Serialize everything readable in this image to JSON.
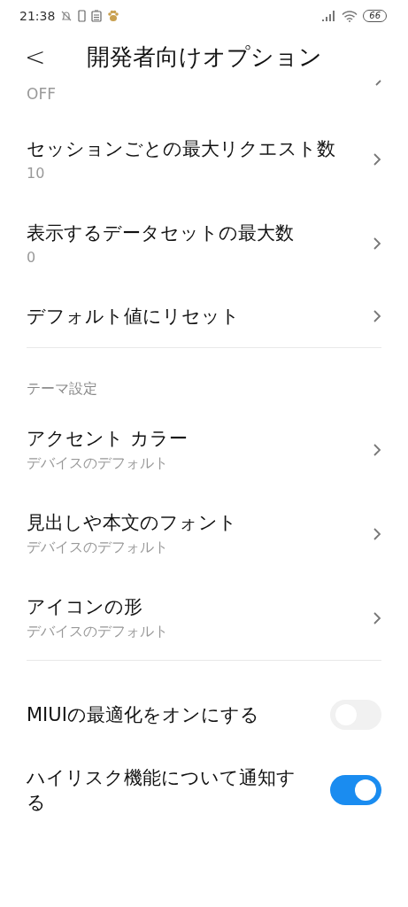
{
  "status_bar": {
    "time": "21:38",
    "battery": "66"
  },
  "header": {
    "back": "<",
    "title": "開発者向けオプション"
  },
  "sections": [
    {
      "items": [
        {
          "kind": "cut",
          "value": "OFF"
        },
        {
          "kind": "link",
          "title": "セッションごとの最大リクエスト数",
          "value": "10"
        },
        {
          "kind": "link",
          "title": "表示するデータセットの最大数",
          "value": "0"
        },
        {
          "kind": "link",
          "title": "デフォルト値にリセット"
        }
      ]
    },
    {
      "heading": "テーマ設定",
      "items": [
        {
          "kind": "link",
          "title": "アクセント カラー",
          "value": "デバイスのデフォルト"
        },
        {
          "kind": "link",
          "title": "見出しや本文のフォント",
          "value": "デバイスのデフォルト"
        },
        {
          "kind": "link",
          "title": "アイコンの形",
          "value": "デバイスのデフォルト"
        }
      ]
    },
    {
      "items": [
        {
          "kind": "switch",
          "title": "MIUIの最適化をオンにする",
          "on": false,
          "disabled": true
        },
        {
          "kind": "switch",
          "title": "ハイリスク機能について通知する",
          "on": true,
          "disabled": false
        }
      ]
    }
  ]
}
